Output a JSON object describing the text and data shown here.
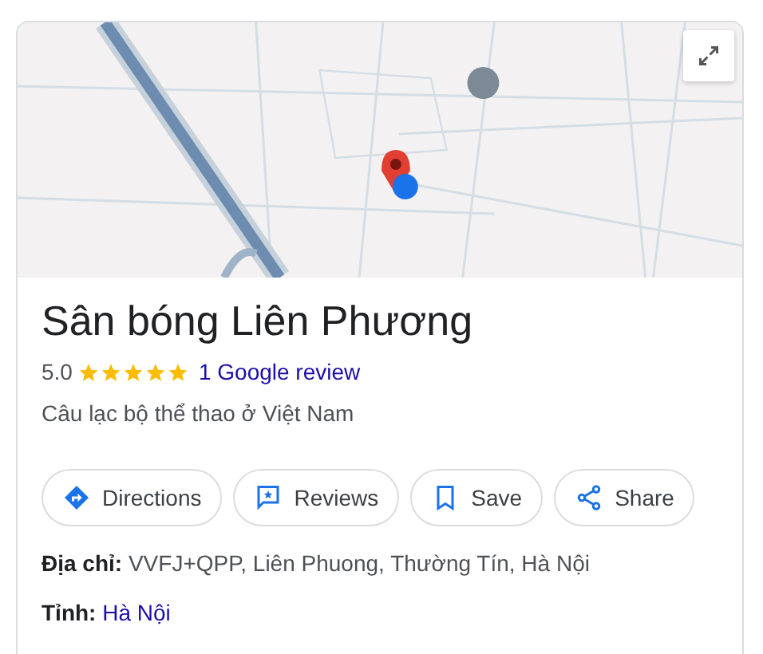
{
  "place": {
    "name": "Sân bóng Liên Phương",
    "rating": "5.0",
    "stars": 5,
    "review_link": "1 Google review",
    "category": "Câu lạc bộ thể thao ở Việt Nam"
  },
  "actions": [
    {
      "kind": "directions",
      "label": "Directions"
    },
    {
      "kind": "reviews",
      "label": "Reviews"
    },
    {
      "kind": "save",
      "label": "Save"
    },
    {
      "kind": "share",
      "label": "Share"
    }
  ],
  "details": [
    {
      "label": "Địa chỉ:",
      "value": "VVFJ+QPP, Liên Phuong, Thường Tín, Hà Nội",
      "link": false
    },
    {
      "label": "Tỉnh:",
      "value": "Hà Nội",
      "link": true
    }
  ]
}
